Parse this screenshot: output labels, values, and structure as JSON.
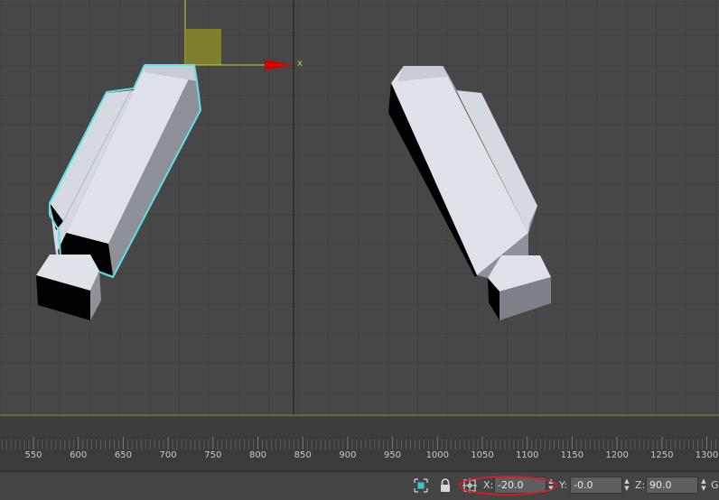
{
  "viewport": {
    "axis_label": "x",
    "colors": {
      "selection_outline": "#5fe0e8",
      "gizmo_yellow": "#cfcf3a",
      "gizmo_red": "#d40000",
      "face_light": "#d9dde6",
      "face_mid": "#8d9096",
      "face_dark": "#000000"
    }
  },
  "timeline": {
    "tick_labels": [
      "550",
      "600",
      "650",
      "700",
      "750",
      "800",
      "850",
      "900",
      "950",
      "1000",
      "1050",
      "1100",
      "1150",
      "1200",
      "1250",
      "1300"
    ]
  },
  "status_bar": {
    "icons": [
      "selection-mode-icon",
      "lock-icon",
      "absolute-offset-mode-icon"
    ],
    "x_label": "X:",
    "x_value": "-20.0",
    "y_label": "Y:",
    "y_value": "-0.0",
    "z_label": "Z:",
    "z_value": "90.0",
    "grid_label": "G"
  }
}
